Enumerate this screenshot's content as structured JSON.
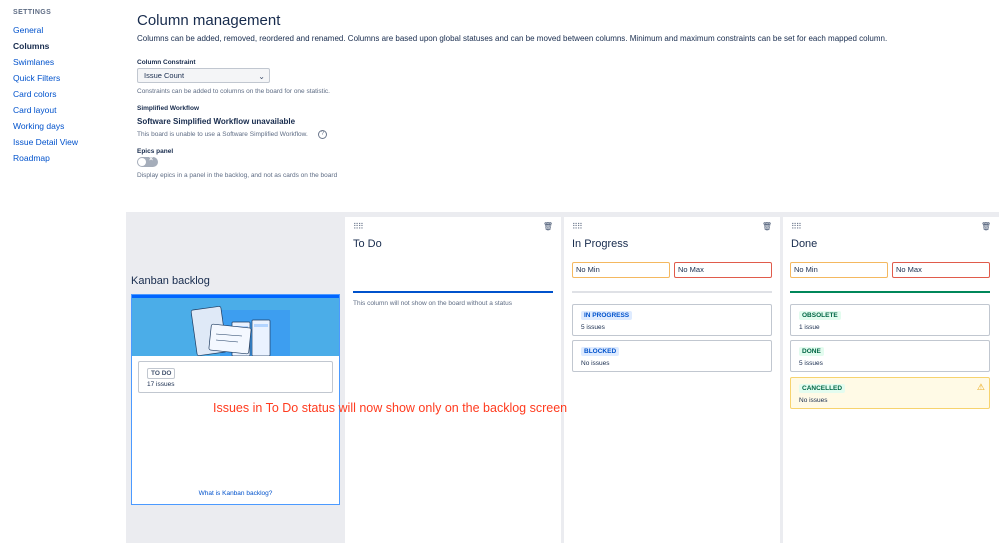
{
  "sidebar": {
    "heading": "SETTINGS",
    "items": [
      {
        "label": "General"
      },
      {
        "label": "Columns",
        "active": true
      },
      {
        "label": "Swimlanes"
      },
      {
        "label": "Quick Filters"
      },
      {
        "label": "Card colors"
      },
      {
        "label": "Card layout"
      },
      {
        "label": "Working days"
      },
      {
        "label": "Issue Detail View"
      },
      {
        "label": "Roadmap"
      }
    ]
  },
  "header": {
    "title": "Column management",
    "description": "Columns can be added, removed, reordered and renamed. Columns are based upon global statuses and can be moved between columns. Minimum and maximum constraints can be set for each mapped column."
  },
  "constraint": {
    "label": "Column Constraint",
    "value": "Issue Count",
    "help": "Constraints can be added to columns on the board for one statistic."
  },
  "workflow": {
    "label": "Simplified Workflow",
    "heading": "Software Simplified Workflow unavailable",
    "help": "This board is unable to use a Software Simplified Workflow."
  },
  "epics": {
    "label": "Epics panel",
    "enabled": false,
    "help": "Display epics in a panel in the backlog, and not as cards on the board"
  },
  "backlog": {
    "title": "Kanban backlog",
    "status_name": "TO DO",
    "status_count": "17 issues",
    "link": "What is Kanban backlog?"
  },
  "columns": {
    "todo": {
      "title": "To Do",
      "empty_text": "This column will not show on the board without a status"
    },
    "inprogress": {
      "title": "In Progress",
      "min_placeholder": "No Min",
      "max_placeholder": "No Max",
      "statuses": [
        {
          "name": "IN PROGRESS",
          "count": "5 issues"
        },
        {
          "name": "BLOCKED",
          "count": "No issues"
        }
      ]
    },
    "done": {
      "title": "Done",
      "min_placeholder": "No Min",
      "max_placeholder": "No Max",
      "statuses": [
        {
          "name": "OBSOLETE",
          "count": "1 issue"
        },
        {
          "name": "DONE",
          "count": "5 issues"
        },
        {
          "name": "CANCELLED",
          "count": "No issues"
        }
      ]
    }
  },
  "annotation": "Issues in To Do status will now show only on the backlog screen",
  "colors": {
    "todo_bar": "#0052cc",
    "inprogress_bar": "#dfe1e6",
    "done_bar": "#00875a",
    "annotation": "#ff3b1f"
  }
}
